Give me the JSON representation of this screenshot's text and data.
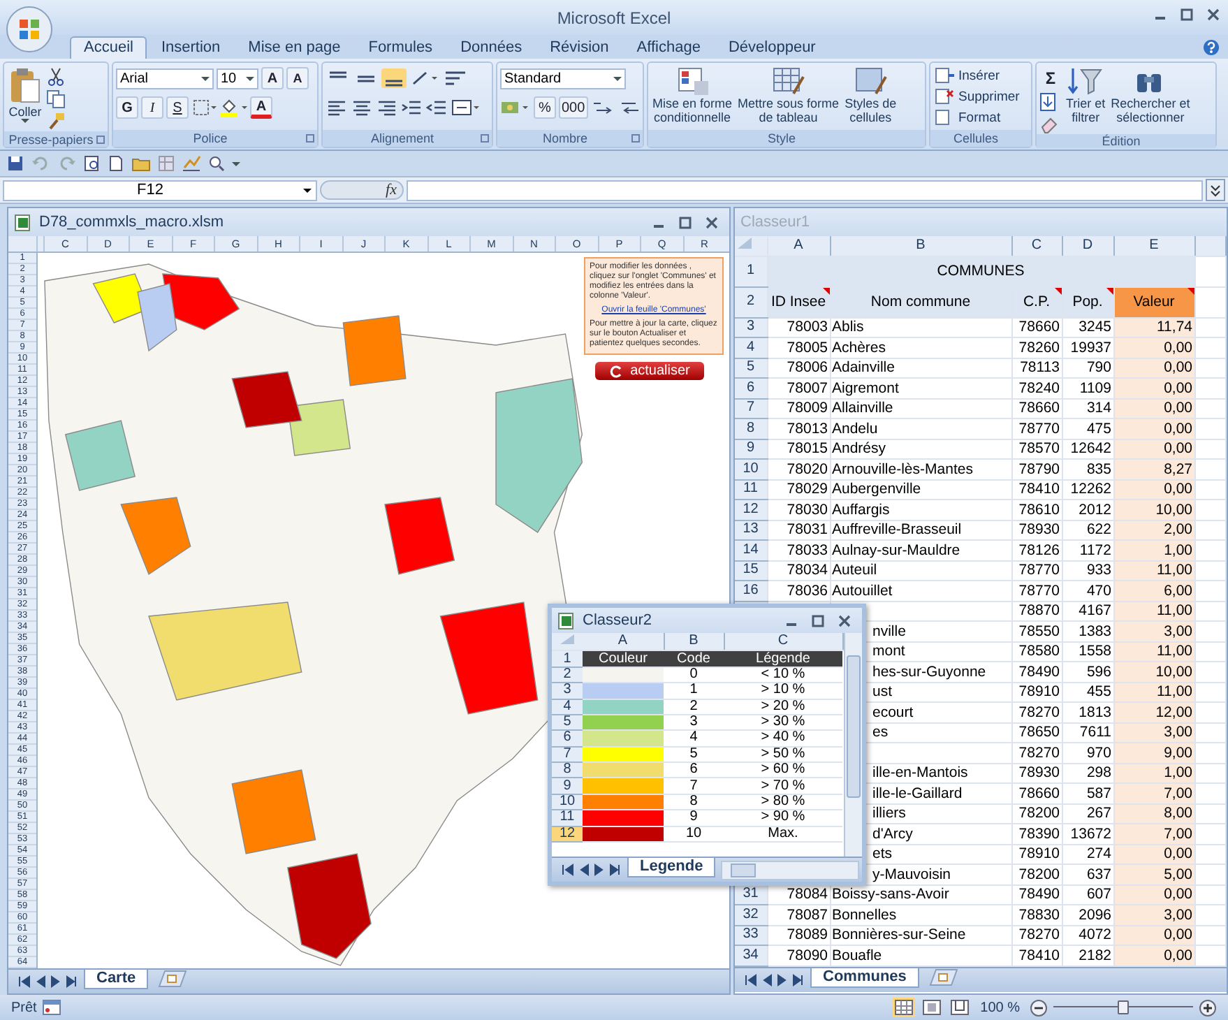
{
  "window": {
    "title": "Microsoft Excel"
  },
  "tabs": [
    {
      "label": "Accueil",
      "selected": true
    },
    {
      "label": "Insertion",
      "selected": false
    },
    {
      "label": "Mise en page",
      "selected": false
    },
    {
      "label": "Formules",
      "selected": false
    },
    {
      "label": "Données",
      "selected": false
    },
    {
      "label": "Révision",
      "selected": false
    },
    {
      "label": "Affichage",
      "selected": false
    },
    {
      "label": "Développeur",
      "selected": false
    }
  ],
  "ribbon": {
    "clipboard": {
      "label": "Presse-papiers",
      "paste": "Coller"
    },
    "font": {
      "label": "Police",
      "name": "Arial",
      "size": "10",
      "grow": "A",
      "shrink": "A",
      "bold": "G",
      "italic": "I",
      "underline": "S",
      "font_color_button": "A"
    },
    "alignment": {
      "label": "Alignement"
    },
    "number": {
      "label": "Nombre",
      "format": "Standard",
      "percent": "%",
      "thousands": "000"
    },
    "styles": {
      "label": "Style",
      "buttons": [
        {
          "lines": [
            "Mise en forme",
            "conditionnelle"
          ]
        },
        {
          "lines": [
            "Mettre sous forme",
            "de tableau"
          ]
        },
        {
          "lines": [
            "Styles de",
            "cellules"
          ]
        }
      ]
    },
    "cells": {
      "label": "Cellules",
      "buttons": [
        "Insérer",
        "Supprimer",
        "Format"
      ]
    },
    "editing": {
      "label": "Édition",
      "sum": "Σ",
      "buttons": [
        {
          "lines": [
            "Trier et",
            "filtrer"
          ]
        },
        {
          "lines": [
            "Rechercher et",
            "sélectionner"
          ]
        }
      ]
    }
  },
  "formula_bar": {
    "name_box": "F12",
    "fx": "fx"
  },
  "map_window": {
    "title": "D78_commxls_macro.xlsm",
    "columns": [
      "C",
      "D",
      "E",
      "F",
      "G",
      "H",
      "I",
      "J",
      "K",
      "L",
      "M",
      "N",
      "O",
      "P",
      "Q",
      "R"
    ],
    "rows": [
      "1",
      "2",
      "3",
      "4",
      "5",
      "6",
      "7",
      "8",
      "9",
      "10",
      "11",
      "12",
      "13",
      "14",
      "15",
      "16",
      "17",
      "18",
      "19",
      "20",
      "21",
      "22",
      "23",
      "24",
      "25",
      "26",
      "27",
      "28",
      "29",
      "30",
      "31",
      "32",
      "33",
      "34",
      "35",
      "36",
      "37",
      "38",
      "39",
      "40",
      "41",
      "42",
      "43",
      "44",
      "45",
      "46",
      "47",
      "48",
      "49",
      "50",
      "51",
      "52",
      "53",
      "54",
      "55",
      "56",
      "57",
      "58",
      "59",
      "60",
      "61",
      "62",
      "63",
      "64"
    ],
    "note": {
      "text1": "Pour modifier les données , cliquez sur l'onglet 'Communes' et modifiez les entrées dans la colonne 'Valeur'.",
      "link": "Ouvrir la feuille 'Communes'",
      "text2": "Pour mettre à jour la carte, cliquez sur le bouton Actualiser et patientez quelques secondes."
    },
    "button": "actualiser",
    "sheets": [
      {
        "label": "Carte",
        "selected": true
      }
    ]
  },
  "table_window": {
    "title": "Classeur1",
    "columns": [
      "A",
      "B",
      "C",
      "D",
      "E"
    ],
    "title_row": "COMMUNES",
    "headers": [
      {
        "label": "ID Insee",
        "comment": true
      },
      {
        "label": "Nom commune",
        "comment": false
      },
      {
        "label": "C.P.",
        "comment": true
      },
      {
        "label": "Pop.",
        "comment": true
      },
      {
        "label": "Valeur",
        "comment": true
      }
    ],
    "rows": [
      {
        "row": "1"
      },
      {
        "row": "2"
      },
      {
        "row": "3",
        "id": "78003",
        "name": "Ablis",
        "cp": "78660",
        "pop": "3245",
        "value": "11,74"
      },
      {
        "row": "4",
        "id": "78005",
        "name": "Achères",
        "cp": "78260",
        "pop": "19937",
        "value": "0,00"
      },
      {
        "row": "5",
        "id": "78006",
        "name": "Adainville",
        "cp": "78113",
        "pop": "790",
        "value": "0,00"
      },
      {
        "row": "6",
        "id": "78007",
        "name": "Aigremont",
        "cp": "78240",
        "pop": "1109",
        "value": "0,00"
      },
      {
        "row": "7",
        "id": "78009",
        "name": "Allainville",
        "cp": "78660",
        "pop": "314",
        "value": "0,00"
      },
      {
        "row": "8",
        "id": "78013",
        "name": "Andelu",
        "cp": "78770",
        "pop": "475",
        "value": "0,00"
      },
      {
        "row": "9",
        "id": "78015",
        "name": "Andrésy",
        "cp": "78570",
        "pop": "12642",
        "value": "0,00"
      },
      {
        "row": "10",
        "id": "78020",
        "name": "Arnouville-lès-Mantes",
        "cp": "78790",
        "pop": "835",
        "value": "8,27"
      },
      {
        "row": "11",
        "id": "78029",
        "name": "Aubergenville",
        "cp": "78410",
        "pop": "12262",
        "value": "0,00"
      },
      {
        "row": "12",
        "id": "78030",
        "name": "Auffargis",
        "cp": "78610",
        "pop": "2012",
        "value": "10,00"
      },
      {
        "row": "13",
        "id": "78031",
        "name": "Auffreville-Brasseuil",
        "cp": "78930",
        "pop": "622",
        "value": "2,00"
      },
      {
        "row": "14",
        "id": "78033",
        "name": "Aulnay-sur-Mauldre",
        "cp": "78126",
        "pop": "1172",
        "value": "1,00"
      },
      {
        "row": "15",
        "id": "78034",
        "name": "Auteuil",
        "cp": "78770",
        "pop": "933",
        "value": "11,00"
      },
      {
        "row": "16",
        "id": "78036",
        "name": "Autouillet",
        "cp": "78770",
        "pop": "470",
        "value": "6,00"
      },
      {
        "cp": "78870",
        "pop": "4167",
        "value": "11,00"
      },
      {
        "name": "nville",
        "cp": "78550",
        "pop": "1383",
        "value": "3,00"
      },
      {
        "name": "mont",
        "cp": "78580",
        "pop": "1558",
        "value": "11,00"
      },
      {
        "name": "hes-sur-Guyonne",
        "cp": "78490",
        "pop": "596",
        "value": "10,00"
      },
      {
        "name": "ust",
        "cp": "78910",
        "pop": "455",
        "value": "11,00"
      },
      {
        "name": "ecourt",
        "cp": "78270",
        "pop": "1813",
        "value": "12,00"
      },
      {
        "name": "es",
        "cp": "78650",
        "pop": "7611",
        "value": "3,00"
      },
      {
        "cp": "78270",
        "pop": "970",
        "value": "9,00"
      },
      {
        "name": "ille-en-Mantois",
        "cp": "78930",
        "pop": "298",
        "value": "1,00"
      },
      {
        "name": "ille-le-Gaillard",
        "cp": "78660",
        "pop": "587",
        "value": "7,00"
      },
      {
        "name": "illiers",
        "cp": "78200",
        "pop": "267",
        "value": "8,00"
      },
      {
        "name": "d'Arcy",
        "cp": "78390",
        "pop": "13672",
        "value": "7,00"
      },
      {
        "name": "ets",
        "cp": "78910",
        "pop": "274",
        "value": "0,00"
      },
      {
        "name": "y-Mauvoisin",
        "cp": "78200",
        "pop": "637",
        "value": "5,00"
      },
      {
        "row": "31",
        "id": "78084",
        "name": "Boissy-sans-Avoir",
        "cp": "78490",
        "pop": "607",
        "value": "0,00"
      },
      {
        "row": "32",
        "id": "78087",
        "name": "Bonnelles",
        "cp": "78830",
        "pop": "2096",
        "value": "3,00"
      },
      {
        "row": "33",
        "id": "78089",
        "name": "Bonnières-sur-Seine",
        "cp": "78270",
        "pop": "4072",
        "value": "0,00"
      },
      {
        "row": "34",
        "id": "78090",
        "name": "Bouafle",
        "cp": "78410",
        "pop": "2182",
        "value": "0,00"
      }
    ],
    "sheets": [
      {
        "label": "Communes",
        "selected": true
      }
    ]
  },
  "legend_window": {
    "title": "Classeur2",
    "columns": [
      "A",
      "B",
      "C"
    ],
    "header_row": "1",
    "headers": [
      "Couleur",
      "Code",
      "Légende"
    ],
    "rows": [
      {
        "num": "2",
        "color": "#f6f4ef",
        "code": "0",
        "legend": "< 10 %",
        "selected": false
      },
      {
        "num": "3",
        "color": "#b9cdf3",
        "code": "1",
        "legend": "> 10 %",
        "selected": false
      },
      {
        "num": "4",
        "color": "#93d3c3",
        "code": "2",
        "legend": "> 20 %",
        "selected": false
      },
      {
        "num": "5",
        "color": "#92d050",
        "code": "3",
        "legend": "> 30 %",
        "selected": false
      },
      {
        "num": "6",
        "color": "#d3e68c",
        "code": "4",
        "legend": "> 40 %",
        "selected": false
      },
      {
        "num": "7",
        "color": "#ffff00",
        "code": "5",
        "legend": "> 50 %",
        "selected": false
      },
      {
        "num": "8",
        "color": "#f1dc6e",
        "code": "6",
        "legend": "> 60 %",
        "selected": false
      },
      {
        "num": "9",
        "color": "#ffc000",
        "code": "7",
        "legend": "> 70 %",
        "selected": false
      },
      {
        "num": "10",
        "color": "#ff8000",
        "code": "8",
        "legend": "> 80 %",
        "selected": false
      },
      {
        "num": "11",
        "color": "#ff0000",
        "code": "9",
        "legend": "> 90 %",
        "selected": false
      },
      {
        "num": "12",
        "color": "#c00000",
        "code": "10",
        "legend": "Max.",
        "selected": true
      }
    ],
    "sheets": [
      {
        "label": "Legende",
        "selected": true
      }
    ]
  },
  "status_bar": {
    "text": "Prêt",
    "zoom": {
      "label": "100 %",
      "level": 0.5
    }
  }
}
